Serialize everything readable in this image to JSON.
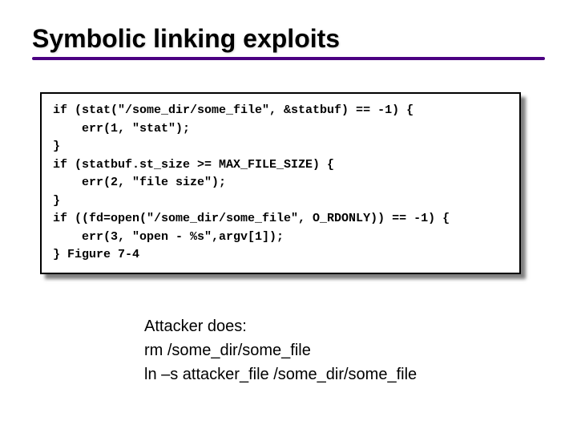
{
  "title": "Symbolic linking exploits",
  "code": "if (stat(\"/some_dir/some_file\", &statbuf) == -1) {\n    err(1, \"stat\");\n}\nif (statbuf.st_size >= MAX_FILE_SIZE) {\n    err(2, \"file size\");\n}\nif ((fd=open(\"/some_dir/some_file\", O_RDONLY)) == -1) {\n    err(3, \"open - %s\",argv[1]);\n} Figure 7-4",
  "attacker": {
    "line1": "Attacker does:",
    "line2": "rm /some_dir/some_file",
    "line3": "ln –s attacker_file /some_dir/some_file"
  }
}
